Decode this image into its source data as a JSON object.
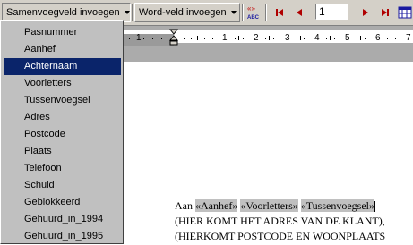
{
  "toolbar": {
    "merge_field_label": "Samenvoegveld invoegen",
    "word_field_label": "Word-veld invoegen",
    "abc_label": "ABC",
    "record_number": "1"
  },
  "dropdown": {
    "items": [
      {
        "label": "Pasnummer"
      },
      {
        "label": "Aanhef"
      },
      {
        "label": "Achternaam"
      },
      {
        "label": "Voorletters"
      },
      {
        "label": "Tussenvoegsel"
      },
      {
        "label": "Adres"
      },
      {
        "label": "Postcode"
      },
      {
        "label": "Plaats"
      },
      {
        "label": "Telefoon"
      },
      {
        "label": "Schuld"
      },
      {
        "label": "Geblokkeerd"
      },
      {
        "label": "Gehuurd_in_1994"
      },
      {
        "label": "Gehuurd_in_1995"
      }
    ],
    "selected": "Achternaam"
  },
  "ruler": {
    "numbers": [
      "1",
      "1",
      "2",
      "3",
      "4",
      "5",
      "6",
      "7"
    ]
  },
  "document": {
    "line1_prefix": "Aan ",
    "field_aanhef": "«Aanhef»",
    "field_voorletters": "«Voorletters»",
    "field_tussenvoegsel": "«Tussenvoegsel»",
    "line2": "(HIER KOMT HET ADRES VAN DE KLANT),",
    "line3": "(HIERKOMT POSTCODE EN WOONPLAATS"
  }
}
